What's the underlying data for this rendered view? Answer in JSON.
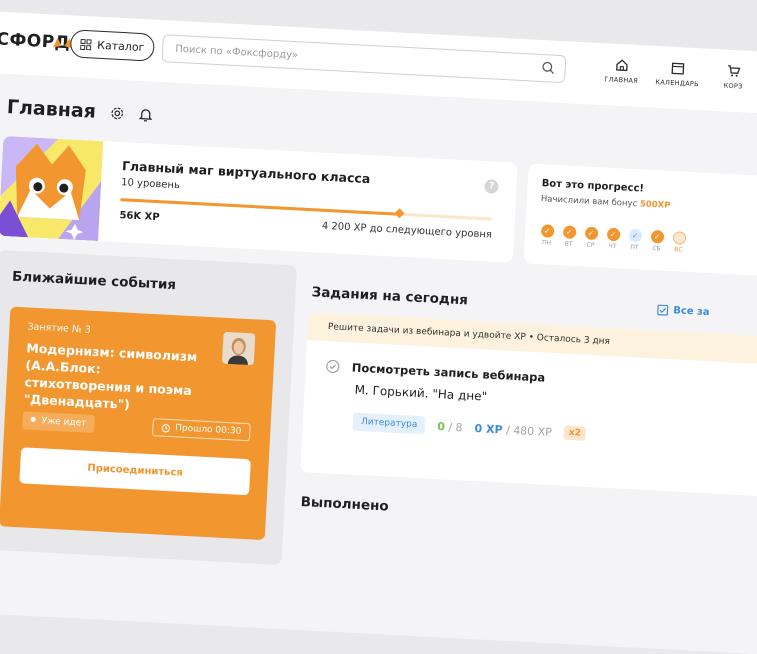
{
  "header": {
    "logo_text": "СФОРД",
    "catalog_label": "Каталог",
    "search_placeholder": "Поиск по «Фоксфорду»",
    "nav": [
      {
        "label": "ГЛАВНАЯ",
        "icon": "home-icon"
      },
      {
        "label": "КАЛЕНДАРЬ",
        "icon": "calendar-icon"
      },
      {
        "label": "КОРЗ",
        "icon": "cart-icon"
      }
    ]
  },
  "page": {
    "title": "Главная"
  },
  "level_card": {
    "title": "Главный маг виртуального класса",
    "level": "10 уровень",
    "help": "?",
    "progress_fraction": 0.75,
    "xp": "56K XP",
    "next_level": "4 200 XP до следующего уровня"
  },
  "progress_card": {
    "title": "Вот это прогресс!",
    "bonus_prefix": "Начислили вам бонус",
    "bonus_value": "500XP",
    "days": [
      {
        "label": "ПН",
        "state": "done"
      },
      {
        "label": "ВТ",
        "state": "done"
      },
      {
        "label": "СР",
        "state": "done"
      },
      {
        "label": "ЧТ",
        "state": "done"
      },
      {
        "label": "ПТ",
        "state": "light"
      },
      {
        "label": "СБ",
        "state": "done"
      },
      {
        "label": "ВС",
        "state": "empty"
      }
    ]
  },
  "events": {
    "heading": "Ближайшие события",
    "card": {
      "label": "Занятие  № 3",
      "title": "Модернизм: символизм (А.А.Блок: стихотворения и поэма \"Двенадцать\")",
      "status": "Уже идет",
      "passed": "Прошло 00:30",
      "join": "Присоединиться"
    }
  },
  "tasks": {
    "heading": "Задания на сегодня",
    "all_link": "Все за",
    "banner": "Решите задачи из вебинара и удвойте XP • Осталось 3 дня",
    "item": {
      "name": "Посмотреть запись вебинара",
      "subtitle": "М. Горький. \"На дне\"",
      "subject": "Литература",
      "count_done": "0",
      "count_total": "/ 8",
      "xp_done": "0 XP",
      "xp_total": "/ 480 XP",
      "multiplier": "x2"
    }
  },
  "done": {
    "heading": "Выполнено"
  },
  "colors": {
    "accent": "#f2962f",
    "blue": "#3d8bdc",
    "green": "#7cc25a"
  }
}
